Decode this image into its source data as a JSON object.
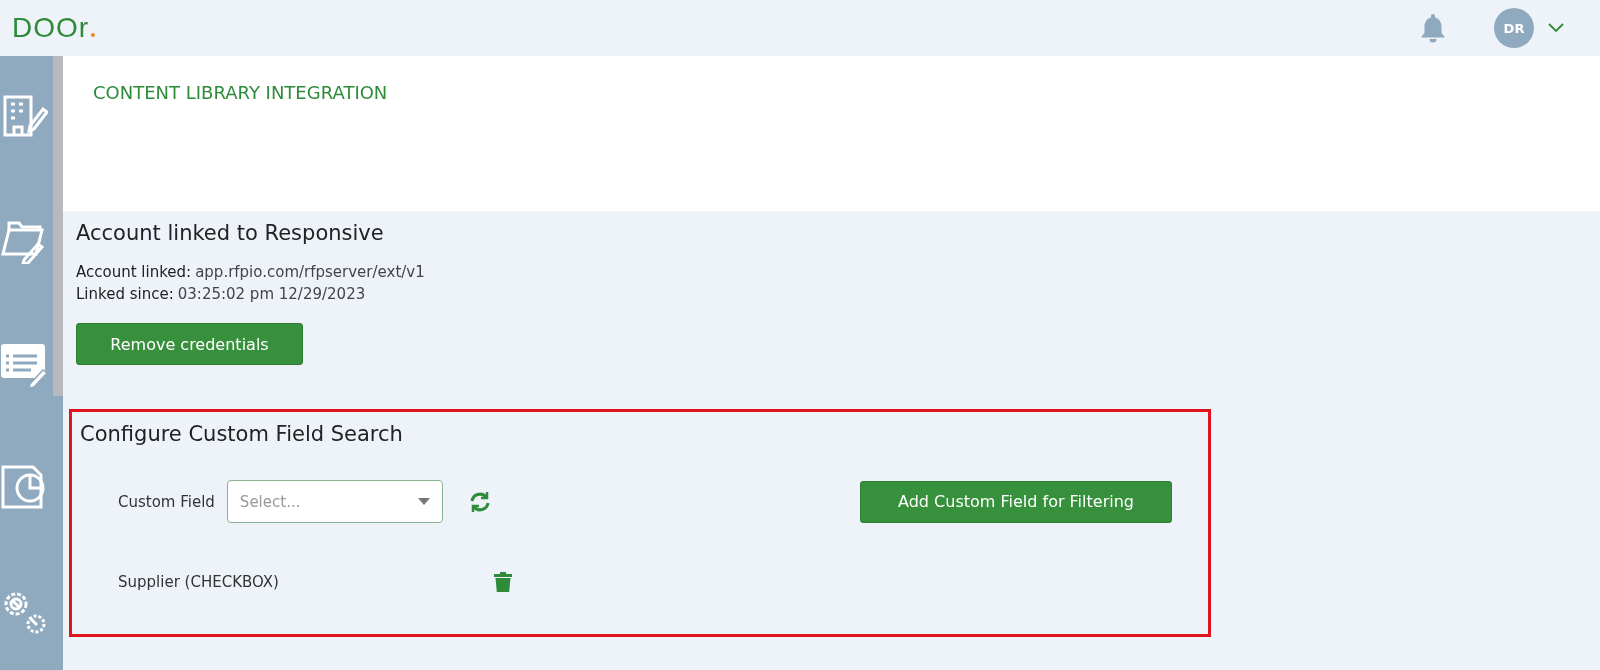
{
  "header": {
    "logo": "DOOr",
    "user_initials": "DR"
  },
  "sidebar": {
    "items": [
      {
        "kind": "building"
      },
      {
        "kind": "folder"
      },
      {
        "kind": "list"
      },
      {
        "kind": "report"
      },
      {
        "kind": "gears"
      }
    ]
  },
  "page_title": "CONTENT LIBRARY INTEGRATION",
  "account": {
    "title": "Account linked to Responsive",
    "lines": [
      {
        "label": "Account linked:",
        "value": "app.rfpio.com/rfpserver/ext/v1"
      },
      {
        "label": "Linked since:",
        "value": "03:25:02 pm 12/29/2023"
      }
    ],
    "button": "Remove credentials"
  },
  "custom_fields": {
    "title": "Configure Custom Field Search",
    "highlighted": true,
    "field_label": "Custom Field",
    "select": {
      "placeholder": "Select..."
    },
    "add_button": "Add Custom Field for Filtering",
    "items": [
      {
        "name": "Supplier (CHECKBOX)"
      }
    ]
  }
}
